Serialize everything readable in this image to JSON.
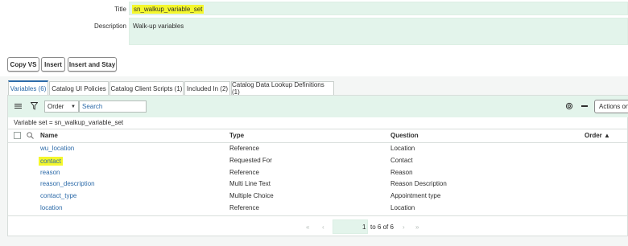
{
  "form": {
    "title_label": "Title",
    "title_value": "sn_walkup_variable_set",
    "description_label": "Description",
    "description_value": "Walk-up variables"
  },
  "buttons": {
    "copy_vs": "Copy VS",
    "insert": "Insert",
    "insert_and_stay": "Insert and Stay"
  },
  "tabs": [
    {
      "label": "Variables (6)"
    },
    {
      "label": "Catalog UI Policies"
    },
    {
      "label": "Catalog Client Scripts (1)"
    },
    {
      "label": "Included In (2)"
    },
    {
      "label": "Catalog Data Lookup Definitions (1)"
    }
  ],
  "toolbar": {
    "order_option": "Order",
    "search_placeholder": "Search",
    "actions_label": "Actions on"
  },
  "filter_breadcrumb": "Variable set = sn_walkup_variable_set",
  "table": {
    "columns": {
      "name": "Name",
      "type": "Type",
      "question": "Question",
      "order": "Order ▲"
    },
    "rows": [
      {
        "name": "wu_location",
        "type": "Reference",
        "question": "Location"
      },
      {
        "name": "contact",
        "type": "Requested For",
        "question": "Contact"
      },
      {
        "name": "reason",
        "type": "Reference",
        "question": "Reason"
      },
      {
        "name": "reason_description",
        "type": "Multi Line Text",
        "question": "Reason Description"
      },
      {
        "name": "contact_type",
        "type": "Multiple Choice",
        "question": "Appointment type"
      },
      {
        "name": "location",
        "type": "Reference",
        "question": "Location"
      }
    ]
  },
  "pagination": {
    "page_start": "1",
    "range_text": "to 6 of 6"
  },
  "colors": {
    "accent": "#2d6ba9",
    "field_bg": "#e3f4eb",
    "highlight": "#f4f72c"
  },
  "icons": {
    "menu": "hamburger-icon",
    "filter": "funnel-icon",
    "settings": "gear-icon",
    "collapse": "minus-icon",
    "search": "search-icon"
  }
}
